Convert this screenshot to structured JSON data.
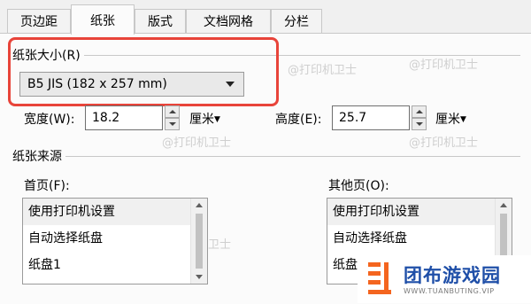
{
  "tabs": [
    {
      "label": "页边距",
      "active": false
    },
    {
      "label": "纸张",
      "active": true
    },
    {
      "label": "版式",
      "active": false
    },
    {
      "label": "文档网格",
      "active": false
    },
    {
      "label": "分栏",
      "active": false
    }
  ],
  "paper_size": {
    "group_label": "纸张大小(R)",
    "selected": "B5 JIS (182 x 257 mm)"
  },
  "width_field": {
    "label": "宽度(W):",
    "value": "18.2",
    "unit": "厘米"
  },
  "height_field": {
    "label": "高度(E):",
    "value": "25.7",
    "unit": "厘米"
  },
  "paper_source": {
    "group_label": "纸张来源",
    "first_page": {
      "label": "首页(F):",
      "items": [
        "使用打印机设置",
        "自动选择纸盘",
        "纸盘1"
      ],
      "selected_index": 0
    },
    "other_pages": {
      "label": "其他页(O):",
      "items": [
        "使用打印机设置",
        "自动选择纸盘",
        "纸盘1"
      ],
      "selected_index": 0
    }
  },
  "watermark_text": "@打印机卫士",
  "logo": {
    "name": "团布游戏园",
    "url": "WWW.TUANBUTING.VIP"
  },
  "colors": {
    "highlight": "#e8443a",
    "logo_orange": "#f4651f",
    "logo_blue": "#1f4fa8"
  }
}
